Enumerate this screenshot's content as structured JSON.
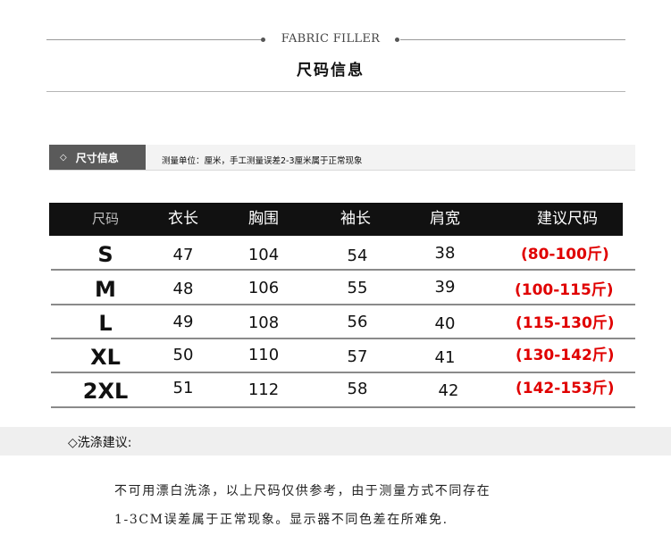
{
  "header": {
    "subtitle": "FABRIC FILLER",
    "title": "尺码信息"
  },
  "size_info": {
    "tab_icon": "◇",
    "tab_label": "尺寸信息",
    "note": "测量单位：厘米，手工测量误差2-3厘米属于正常现象"
  },
  "table": {
    "headers": [
      "尺码",
      "衣长",
      "胸围",
      "袖长",
      "肩宽",
      "建议尺码"
    ],
    "rows": [
      {
        "size": "S",
        "length": "47",
        "chest": "104",
        "sleeve": "54",
        "shoulder": "38",
        "recommend": "(80-100斤)"
      },
      {
        "size": "M",
        "length": "48",
        "chest": "106",
        "sleeve": "55",
        "shoulder": "39",
        "recommend": "(100-115斤)"
      },
      {
        "size": "L",
        "length": "49",
        "chest": "108",
        "sleeve": "56",
        "shoulder": "40",
        "recommend": "(115-130斤)"
      },
      {
        "size": "XL",
        "length": "50",
        "chest": "110",
        "sleeve": "57",
        "shoulder": "41",
        "recommend": "(130-142斤)"
      },
      {
        "size": "2XL",
        "length": "51",
        "chest": "112",
        "sleeve": "58",
        "shoulder": "42",
        "recommend": "(142-153斤)"
      }
    ]
  },
  "washing": {
    "title": "◇洗涤建议:",
    "line1": "不可用漂白洗涤，以上尺码仅供参考，由于测量方式不同存在",
    "line2": "1-3CM误差属于正常现象。显示器不同色差在所难免."
  },
  "colors": {
    "header_bg": "#111111",
    "tab_bg": "#5a5a5a",
    "recommend_red": "#e00000"
  }
}
